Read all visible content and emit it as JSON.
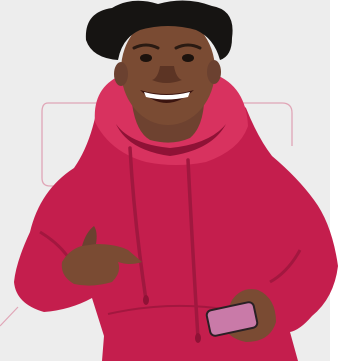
{
  "image": {
    "subject": "",
    "colors": {
      "page": "#ffffff",
      "backdrop": "#ededed",
      "outline": "#e0a6b7",
      "hoodie": "#c41e4d",
      "hoodie_light": "#d8325f",
      "hoodie_shade": "#8f1236",
      "drawstring": "#a0183f",
      "skin": "#7a4b33",
      "skin_shade": "#5c3424",
      "hair": "#161412",
      "teeth": "#ffffff",
      "phone": "#c97aa8",
      "phone_edge": "#2a2024"
    }
  }
}
